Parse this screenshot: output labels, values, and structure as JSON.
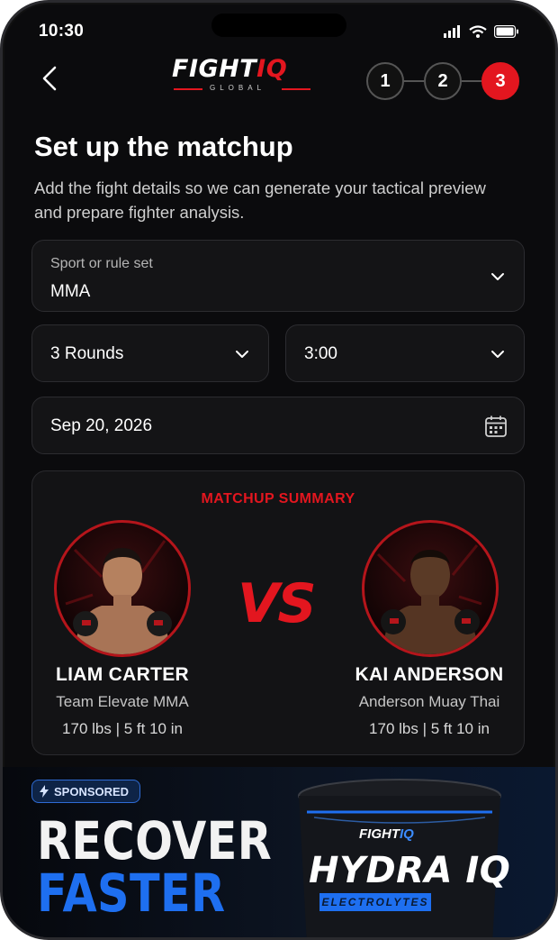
{
  "status": {
    "time": "10:30"
  },
  "header": {
    "logo_main_text": "FIGHT",
    "logo_iq_text": "IQ",
    "logo_sub_text": "GLOBAL",
    "steps": [
      "1",
      "2",
      "3"
    ],
    "active_step": "3"
  },
  "page": {
    "title": "Set up the matchup",
    "subtitle": "Add the fight details so we can generate your tactical preview and prepare fighter analysis."
  },
  "form": {
    "sport": {
      "label": "Sport or rule set",
      "value": "MMA"
    },
    "rounds": {
      "value": "3 Rounds"
    },
    "round_time": {
      "value": "3:00"
    },
    "date": {
      "value": "Sep 20, 2026"
    }
  },
  "summary": {
    "title": "MATCHUP SUMMARY",
    "vs": "VS",
    "fighters": [
      {
        "name": "LIAM CARTER",
        "team": "Team Elevate MMA",
        "stats": "170 lbs  |  5 ft 10 in"
      },
      {
        "name": "KAI ANDERSON",
        "team": "Anderson Muay Thai",
        "stats": "170 lbs  |  5 ft 10 in"
      }
    ]
  },
  "ad": {
    "badge": "SPONSORED",
    "headline_1": "RECOVER",
    "headline_2": "FASTER",
    "product_brand": "FIGHT",
    "product_brand_iq": "IQ",
    "product_name": "HYDRA IQ",
    "product_sub": "ELECTROLYTES"
  },
  "colors": {
    "accent": "#e3161f",
    "background": "#0b0b0d",
    "ad_blue": "#1e6ff0"
  }
}
